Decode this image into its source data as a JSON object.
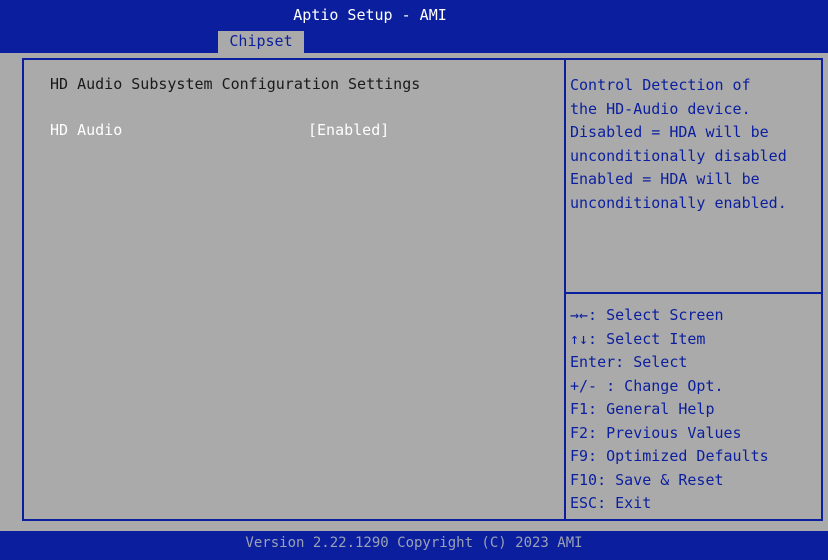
{
  "header": {
    "title": "Aptio Setup - AMI",
    "active_tab": "Chipset"
  },
  "main": {
    "section_heading": "HD Audio Subsystem Configuration Settings",
    "options": [
      {
        "label": "HD Audio",
        "value": "[Enabled]"
      }
    ]
  },
  "help": {
    "lines": [
      "Control Detection of",
      "the HD-Audio device.",
      "Disabled = HDA will be",
      "unconditionally disabled",
      "Enabled = HDA will be",
      "unconditionally enabled."
    ]
  },
  "keys": [
    "→←: Select Screen",
    "↑↓: Select Item",
    "Enter: Select",
    "+/- : Change Opt.",
    "F1: General Help",
    "F2: Previous Values",
    "F9: Optimized Defaults",
    "F10: Save & Reset",
    "ESC: Exit"
  ],
  "footer": {
    "version": "Version 2.22.1290 Copyright (C) 2023 AMI"
  },
  "colors": {
    "panel": "#aaaaaa",
    "bar": "#0b1f9e",
    "text_dark": "#1a1a1a",
    "text_white": "#ffffff"
  }
}
